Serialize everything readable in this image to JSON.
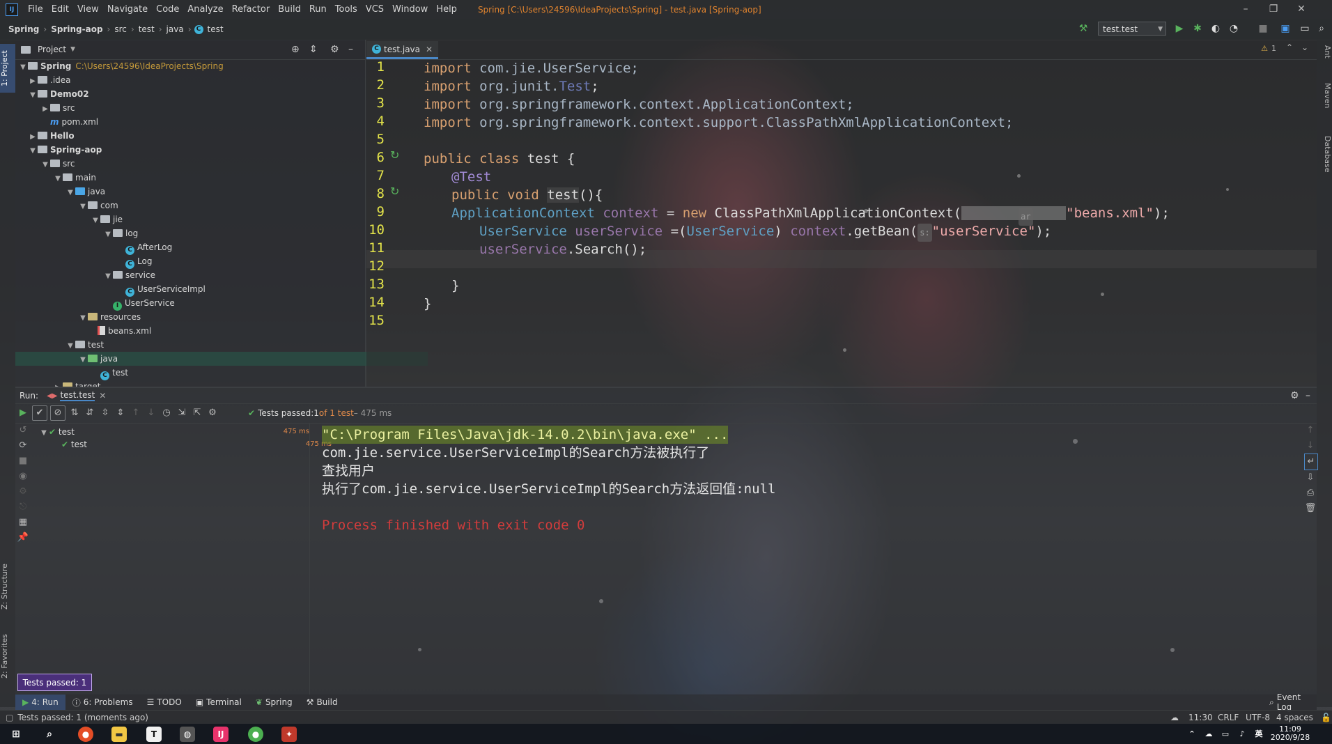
{
  "menubar": {
    "items": [
      "File",
      "Edit",
      "View",
      "Navigate",
      "Code",
      "Analyze",
      "Refactor",
      "Build",
      "Run",
      "Tools",
      "VCS",
      "Window",
      "Help"
    ],
    "window_title": "Spring [C:\\Users\\24596\\IdeaProjects\\Spring] - test.java [Spring-aop]"
  },
  "navbar": {
    "breadcrumbs": [
      "Spring",
      "Spring-aop",
      "src",
      "test",
      "java",
      "test"
    ],
    "run_config": "test.test"
  },
  "left_strip": {
    "project_tab": "1: Project",
    "structure_tab": "Z: Structure",
    "favorites_tab": "2: Favorites"
  },
  "right_strip": {
    "ant_tab": "Ant",
    "maven_tab": "Maven",
    "database_tab": "Database"
  },
  "project_panel": {
    "title": "Project",
    "tree": [
      {
        "label": "Spring",
        "path": "C:\\Users\\24596\\IdeaProjects\\Spring"
      },
      {
        "label": ".idea"
      },
      {
        "label": "Demo02"
      },
      {
        "label": "src"
      },
      {
        "label": "pom.xml"
      },
      {
        "label": "Hello"
      },
      {
        "label": "Spring-aop"
      },
      {
        "label": "src"
      },
      {
        "label": "main"
      },
      {
        "label": "java"
      },
      {
        "label": "com"
      },
      {
        "label": "jie"
      },
      {
        "label": "log"
      },
      {
        "label": "AfterLog"
      },
      {
        "label": "Log"
      },
      {
        "label": "service"
      },
      {
        "label": "UserServiceImpl"
      },
      {
        "label": "UserService"
      },
      {
        "label": "resources"
      },
      {
        "label": "beans.xml"
      },
      {
        "label": "test"
      },
      {
        "label": "java"
      },
      {
        "label": "test"
      },
      {
        "label": "target"
      }
    ]
  },
  "editor": {
    "tab_label": "test.java",
    "warning_count": "1",
    "line_numbers": [
      "1",
      "2",
      "3",
      "4",
      "5",
      "6",
      "7",
      "8",
      "9",
      "10",
      "11",
      "12",
      "13",
      "14",
      "15"
    ],
    "lines": {
      "l1": {
        "kw": "import ",
        "pkg": "com.jie.UserService;"
      },
      "l2": {
        "kw": "import ",
        "pkg": "org.junit.",
        "cls": "Test",
        "end": ";"
      },
      "l3": {
        "kw": "import ",
        "pkg": "org.springframework.context.ApplicationContext;"
      },
      "l4": {
        "kw": "import ",
        "pkg": "org.springframework.context.support.ClassPathXmlApplicationContext;"
      },
      "l6": {
        "kw": "public class ",
        "name": "test",
        "brace": " {"
      },
      "l7": {
        "ann": "@Test"
      },
      "l8": {
        "kw": "public void ",
        "name": "test",
        "rest": "(){"
      },
      "l9": {
        "type": "ApplicationContext ",
        "var": "context",
        "op": " = ",
        "kw": "new ",
        "call": "ClassPathXmlApplicationContext(",
        "hint": "ar",
        "str": "\"beans.xml\"",
        "end": ");"
      },
      "l10": {
        "type": "UserService ",
        "var": "userService",
        "op": " =(",
        "cast": "UserService",
        "mid": ") ",
        "var2": "context",
        "call": ".getBean(",
        "hint": "s:",
        "str": "\"userService\"",
        "end": ");"
      },
      "l11": {
        "var": "userService",
        "call": ".Search();"
      },
      "l13": {
        "brace": "}"
      },
      "l14": {
        "brace": "}"
      }
    }
  },
  "run_panel": {
    "title": "Run:",
    "tab_label": "test.test",
    "status_prefix": "Tests passed: ",
    "status_count": "1",
    "status_of": " of 1 test",
    "status_time": " – 475 ms",
    "tests": [
      {
        "name": "test",
        "duration": "475 ms"
      },
      {
        "name": "test",
        "duration": "475 ms"
      }
    ],
    "console": [
      "\"C:\\Program Files\\Java\\jdk-14.0.2\\bin\\java.exe\" ...",
      "com.jie.service.UserServiceImpl的Search方法被执行了",
      "查找用户",
      "执行了com.jie.service.UserServiceImpl的Search方法返回值:null",
      "Process finished with exit code 0"
    ]
  },
  "toast": "Tests passed: 1",
  "bottom_tabs": {
    "run": "4: Run",
    "problems": "6: Problems",
    "todo": "TODO",
    "terminal": "Terminal",
    "spring": "Spring",
    "build": "Build",
    "event_log": "Event Log"
  },
  "statusbar": {
    "message": "Tests passed: 1 (moments ago)",
    "position": "11:30",
    "line_sep": "CRLF",
    "encoding": "UTF-8",
    "indent": "4 spaces"
  },
  "taskbar": {
    "time": "11:09",
    "date": "2020/9/28"
  },
  "colors": {
    "accent": "#4a88c7",
    "pass_green": "#59b35d",
    "line_number_yellow": "#e4e44a",
    "exit_red": "#d23c3c"
  }
}
